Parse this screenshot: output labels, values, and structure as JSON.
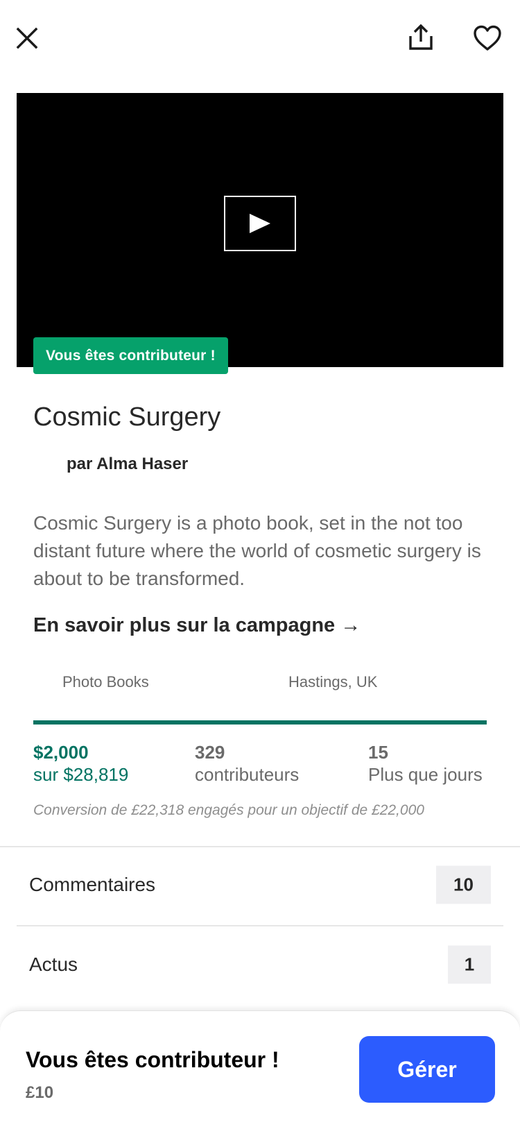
{
  "topbar": {
    "icons": {
      "close": "close-icon",
      "share": "share-icon",
      "favorite": "heart-icon"
    }
  },
  "video": {
    "play_icon": "play-icon"
  },
  "badge": {
    "label": "Vous êtes contributeur !",
    "color": "#06a16b"
  },
  "project": {
    "title": "Cosmic Surgery",
    "author": "par Alma Haser",
    "description": "Cosmic Surgery is a photo book, set in the not too distant future where the world of cosmetic surgery is about to be transformed.",
    "learn_more": "En savoir plus sur la campagne →",
    "category": "Photo Books",
    "location": "Hastings, UK"
  },
  "funding": {
    "progress_percent": 100,
    "progress_color": "#037362",
    "raised": "$2,000",
    "goal": "sur $28,819",
    "backers_count": "329",
    "backers_label": "contributeurs",
    "days_count": "15",
    "days_label": "Plus que jours",
    "conversion_note": "Conversion de £22,318 engagés pour un objectif de £22,000"
  },
  "sections": {
    "comments_label": "Commentaires",
    "comments_count": "10",
    "updates_label": "Actus",
    "updates_count": "1"
  },
  "bottom_bar": {
    "title": "Vous êtes contributeur !",
    "amount": "£10",
    "manage_label": "Gérer",
    "manage_color": "#2c5cfe"
  }
}
